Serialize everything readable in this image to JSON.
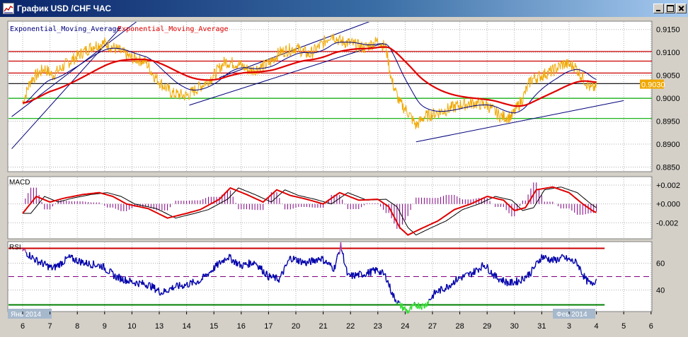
{
  "window": {
    "title": "График USD /CHF  ЧАС",
    "icon": "chart-icon"
  },
  "colors": {
    "price": "#f0a800",
    "ema_fast": "#000080",
    "ema_slow": "#e00000",
    "trend": "#00007a",
    "level_red": "#cc0000",
    "level_green": "#00aa00",
    "level_black": "#000000",
    "macd_hist": "#800080",
    "rsi": "#0000aa",
    "rsi_oversold": "#33dd33",
    "rsi_overbought": "#a040a0",
    "label_bg": "#a6b8cc"
  },
  "chart_data": {
    "type": "line",
    "x_tick_labels": [
      "6",
      "7",
      "8",
      "9",
      "10",
      "13",
      "14",
      "15",
      "16",
      "17",
      "20",
      "21",
      "22",
      "23",
      "24",
      "27",
      "28",
      "29",
      "30",
      "31",
      "3",
      "4",
      "5",
      "6"
    ],
    "month_labels": [
      "Янв 2014",
      "Фев 2014"
    ],
    "panels": [
      {
        "id": "price",
        "legend": [
          "Exponential_Moving_Average",
          "Exponential_Moving_Average"
        ],
        "y_ticks": [
          "0.9150",
          "0.9100",
          "0.9050",
          "0.9000",
          "0.8950",
          "0.8900",
          "0.8850"
        ],
        "ylim": [
          0.884,
          0.9168
        ],
        "current_price_label": "0.9030",
        "current_price": 0.903,
        "horizontal_levels": {
          "red": [
            0.9102,
            0.9081,
            0.9055
          ],
          "black": [
            0.9032
          ],
          "green": [
            0.9,
            0.8956
          ]
        },
        "price_anchors": [
          [
            0,
            0.899
          ],
          [
            0.3,
            0.904
          ],
          [
            0.8,
            0.9065
          ],
          [
            1.1,
            0.905
          ],
          [
            1.6,
            0.9075
          ],
          [
            2.2,
            0.91
          ],
          [
            2.6,
            0.9115
          ],
          [
            3.0,
            0.912
          ],
          [
            3.5,
            0.9105
          ],
          [
            3.9,
            0.909
          ],
          [
            4.5,
            0.908
          ],
          [
            4.8,
            0.905
          ],
          [
            5.1,
            0.903
          ],
          [
            5.5,
            0.901
          ],
          [
            6.0,
            0.9005
          ],
          [
            6.6,
            0.903
          ],
          [
            7.0,
            0.905
          ],
          [
            7.4,
            0.908
          ],
          [
            7.9,
            0.9075
          ],
          [
            8.3,
            0.906
          ],
          [
            8.6,
            0.9065
          ],
          [
            9.0,
            0.9075
          ],
          [
            9.4,
            0.91
          ],
          [
            10.0,
            0.911
          ],
          [
            10.5,
            0.9095
          ],
          [
            11.0,
            0.912
          ],
          [
            11.3,
            0.914
          ],
          [
            11.6,
            0.9125
          ],
          [
            12.0,
            0.912
          ],
          [
            12.5,
            0.911
          ],
          [
            13.0,
            0.9125
          ],
          [
            13.3,
            0.911
          ],
          [
            13.5,
            0.904
          ],
          [
            13.8,
            0.899
          ],
          [
            14.1,
            0.897
          ],
          [
            14.4,
            0.894
          ],
          [
            14.7,
            0.896
          ],
          [
            15.0,
            0.8965
          ],
          [
            15.5,
            0.8975
          ],
          [
            16.0,
            0.8985
          ],
          [
            16.5,
            0.899
          ],
          [
            17.0,
            0.8985
          ],
          [
            17.5,
            0.896
          ],
          [
            17.9,
            0.896
          ],
          [
            18.3,
            0.9
          ],
          [
            18.6,
            0.904
          ],
          [
            19.0,
            0.905
          ],
          [
            19.4,
            0.906
          ],
          [
            19.8,
            0.9075
          ],
          [
            20.2,
            0.907
          ],
          [
            20.5,
            0.9045
          ],
          [
            20.8,
            0.902
          ],
          [
            21.0,
            0.9025
          ]
        ],
        "trend_lines": [
          {
            "from": [
              -0.4,
              0.889
            ],
            "to": [
              3.6,
              0.9155
            ]
          },
          {
            "from": [
              -0.4,
              0.896
            ],
            "to": [
              6.0,
              0.925
            ]
          },
          {
            "from": [
              6.1,
              0.8985
            ],
            "to": [
              13.2,
              0.912
            ]
          },
          {
            "from": [
              7.2,
              0.9045
            ],
            "to": [
              16.2,
              0.9245
            ]
          },
          {
            "from": [
              14.4,
              0.8905
            ],
            "to": [
              22.0,
              0.8995
            ]
          }
        ]
      },
      {
        "id": "macd",
        "label": "MACD",
        "y_ticks": [
          "+0.002",
          "+0.000",
          "-0.002"
        ],
        "ylim": [
          -0.0037,
          0.0029
        ],
        "macd_anchors": [
          [
            0,
            -0.001
          ],
          [
            0.5,
            0.0008
          ],
          [
            1.0,
            0.0002
          ],
          [
            1.5,
            0.0006
          ],
          [
            2.2,
            0.001
          ],
          [
            2.8,
            0.0012
          ],
          [
            3.3,
            0.0008
          ],
          [
            3.8,
            0.0
          ],
          [
            4.6,
            -0.0005
          ],
          [
            5.3,
            -0.0015
          ],
          [
            6.0,
            -0.001
          ],
          [
            6.5,
            -0.0006
          ],
          [
            7.2,
            0.0005
          ],
          [
            7.6,
            0.0017
          ],
          [
            8.2,
            0.001
          ],
          [
            8.8,
            0.0002
          ],
          [
            9.3,
            0.0015
          ],
          [
            9.8,
            0.0009
          ],
          [
            10.4,
            0.0005
          ],
          [
            11.0,
            0.0
          ],
          [
            11.6,
            0.0012
          ],
          [
            12.3,
            0.0004
          ],
          [
            13.0,
            0.0005
          ],
          [
            13.4,
            -0.0003
          ],
          [
            13.8,
            -0.0025
          ],
          [
            14.1,
            -0.0033
          ],
          [
            14.6,
            -0.0026
          ],
          [
            15.2,
            -0.0018
          ],
          [
            15.8,
            -0.0006
          ],
          [
            16.4,
            0.0
          ],
          [
            17.0,
            0.0008
          ],
          [
            17.6,
            0.0004
          ],
          [
            18.0,
            -0.0007
          ],
          [
            18.4,
            -0.0004
          ],
          [
            18.8,
            0.0015
          ],
          [
            19.4,
            0.0018
          ],
          [
            20.0,
            0.0012
          ],
          [
            20.5,
            0.0
          ],
          [
            20.9,
            -0.0008
          ],
          [
            21.0,
            -0.0009
          ]
        ],
        "signal_lag": 0.3
      },
      {
        "id": "rsi",
        "label": "RSI",
        "y_ticks": [
          "60",
          "40"
        ],
        "ylim": [
          24,
          76
        ],
        "levels": [
          71,
          50,
          29
        ],
        "rsi_anchors": [
          [
            0,
            70
          ],
          [
            0.5,
            62
          ],
          [
            1.1,
            56
          ],
          [
            1.7,
            64
          ],
          [
            2.3,
            60
          ],
          [
            2.9,
            58
          ],
          [
            3.4,
            50
          ],
          [
            4.0,
            46
          ],
          [
            4.6,
            44
          ],
          [
            5.1,
            38
          ],
          [
            5.5,
            42
          ],
          [
            6.0,
            44
          ],
          [
            6.5,
            47
          ],
          [
            7.1,
            58
          ],
          [
            7.5,
            65
          ],
          [
            8.0,
            58
          ],
          [
            8.5,
            61
          ],
          [
            9.0,
            50
          ],
          [
            9.4,
            48
          ],
          [
            9.8,
            64
          ],
          [
            10.4,
            60
          ],
          [
            10.9,
            64
          ],
          [
            11.4,
            56
          ],
          [
            11.65,
            73
          ],
          [
            11.9,
            50
          ],
          [
            12.5,
            52
          ],
          [
            13.0,
            55
          ],
          [
            13.3,
            50
          ],
          [
            13.55,
            36
          ],
          [
            13.8,
            29
          ],
          [
            14.1,
            24
          ],
          [
            14.4,
            29
          ],
          [
            14.7,
            28
          ],
          [
            15.1,
            38
          ],
          [
            15.5,
            42
          ],
          [
            15.9,
            48
          ],
          [
            16.4,
            52
          ],
          [
            16.9,
            59
          ],
          [
            17.3,
            50
          ],
          [
            17.8,
            45
          ],
          [
            18.2,
            47
          ],
          [
            18.6,
            53
          ],
          [
            19.0,
            65
          ],
          [
            19.4,
            62
          ],
          [
            19.8,
            64
          ],
          [
            20.3,
            60
          ],
          [
            20.6,
            48
          ],
          [
            20.8,
            44
          ],
          [
            21.0,
            48
          ]
        ]
      }
    ]
  }
}
